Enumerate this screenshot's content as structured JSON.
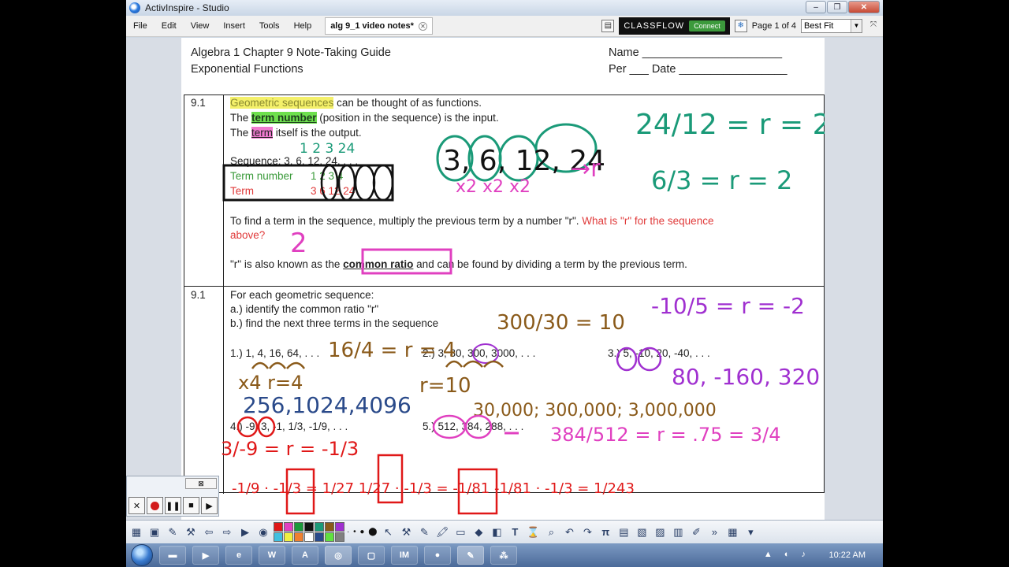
{
  "window": {
    "title": "ActivInspire - Studio"
  },
  "menu": {
    "items": [
      "File",
      "Edit",
      "View",
      "Insert",
      "Tools",
      "Help"
    ],
    "doc_tab": "alg 9_1 video notes*",
    "classflow": "CLASSFLOW",
    "connect": "Connect",
    "page_info": "Page 1 of 4",
    "zoom": "Best Fit"
  },
  "header": {
    "line1": "Algebra 1 Chapter 9 Note-Taking Guide",
    "line2": "Exponential Functions",
    "name": "Name ______________________",
    "per": "Per ___ Date _________________"
  },
  "section1": {
    "num": "9.1",
    "l1_hl": "Geometric sequences",
    "l1_rest": " can be thought of as functions.",
    "l2_pre": "The ",
    "l2_hl": "term number",
    "l2_rest": " (position in the sequence) is the input.",
    "l3_pre": "The ",
    "l3_hl": "term",
    "l3_rest": " itself is the output.",
    "sequence": "Sequence: 3, 6, 12, 24, . . .",
    "term_number_label": "Term number",
    "term_number_vals": "1    2    3    4",
    "term_label": "Term",
    "term_vals": "3    6   12   24",
    "find_1": "To find a term in the sequence, multiply the previous term by a number \"r\".",
    "find_q": " What is \"r\" for the sequence",
    "find_2": "above?",
    "ratio_pre": "\"r\" is also known as the ",
    "ratio_hl": "common ratio",
    "ratio_post": " and can be found by dividing a term by the previous term."
  },
  "section2": {
    "num": "9.1",
    "intro": "For each geometric sequence:",
    "a": "a.) identify the common ratio \"r\"",
    "b": "b.) find the next three terms in the sequence",
    "p1": "1.) 1, 4, 16, 64, . . .",
    "p2": "2.) 3, 30, 300, 3000, . . .",
    "p3": "3.) 5, -10, 20, -40, . . .",
    "p4": "4.) -9, 3, -1, 1/3, -1/9, . . .",
    "p5": "5.) 512, 384, 288, . . ."
  },
  "ink": {
    "top_nums": "1  2  3   24",
    "big_seq": "3, 6, 12, 24",
    "times": "x2  x2  x2",
    "r_arrow": "→r",
    "frac1": "24/12 = r = 2",
    "frac2": "6/3 = r = 2",
    "answer_two": "2",
    "p1_ratio": "16/4 = r = 4",
    "p1_x4": "x4   r=4",
    "p1_terms": "256,1024,4096",
    "p2_frac": "300/30 = 10",
    "p2_r": "r=10",
    "p2_terms": "30,000; 300,000; 3,000,000",
    "p3_ratio": "-10/5 = r = -2",
    "p3_terms": "80, -160, 320",
    "p4_ratio": "3/-9 = r = -1/3",
    "p4_terms": "-1/9 · -1/3 = 1/27   1/27 · -1/3 = -1/81   -1/81 · -1/3 = 1/243",
    "p5_ratio": "384/512 = r = .75 = 3/4"
  },
  "recorder": {
    "close": "⊠"
  },
  "taskbar": {
    "clock": "10:22 AM"
  },
  "colors": {
    "ink_teal": "#1a9a78",
    "ink_magenta": "#e040c0",
    "ink_brown": "#8a5a1a",
    "ink_purple": "#a030d0",
    "ink_red": "#e01818",
    "ink_navy": "#2a4a8a",
    "ink_black": "#111111"
  }
}
